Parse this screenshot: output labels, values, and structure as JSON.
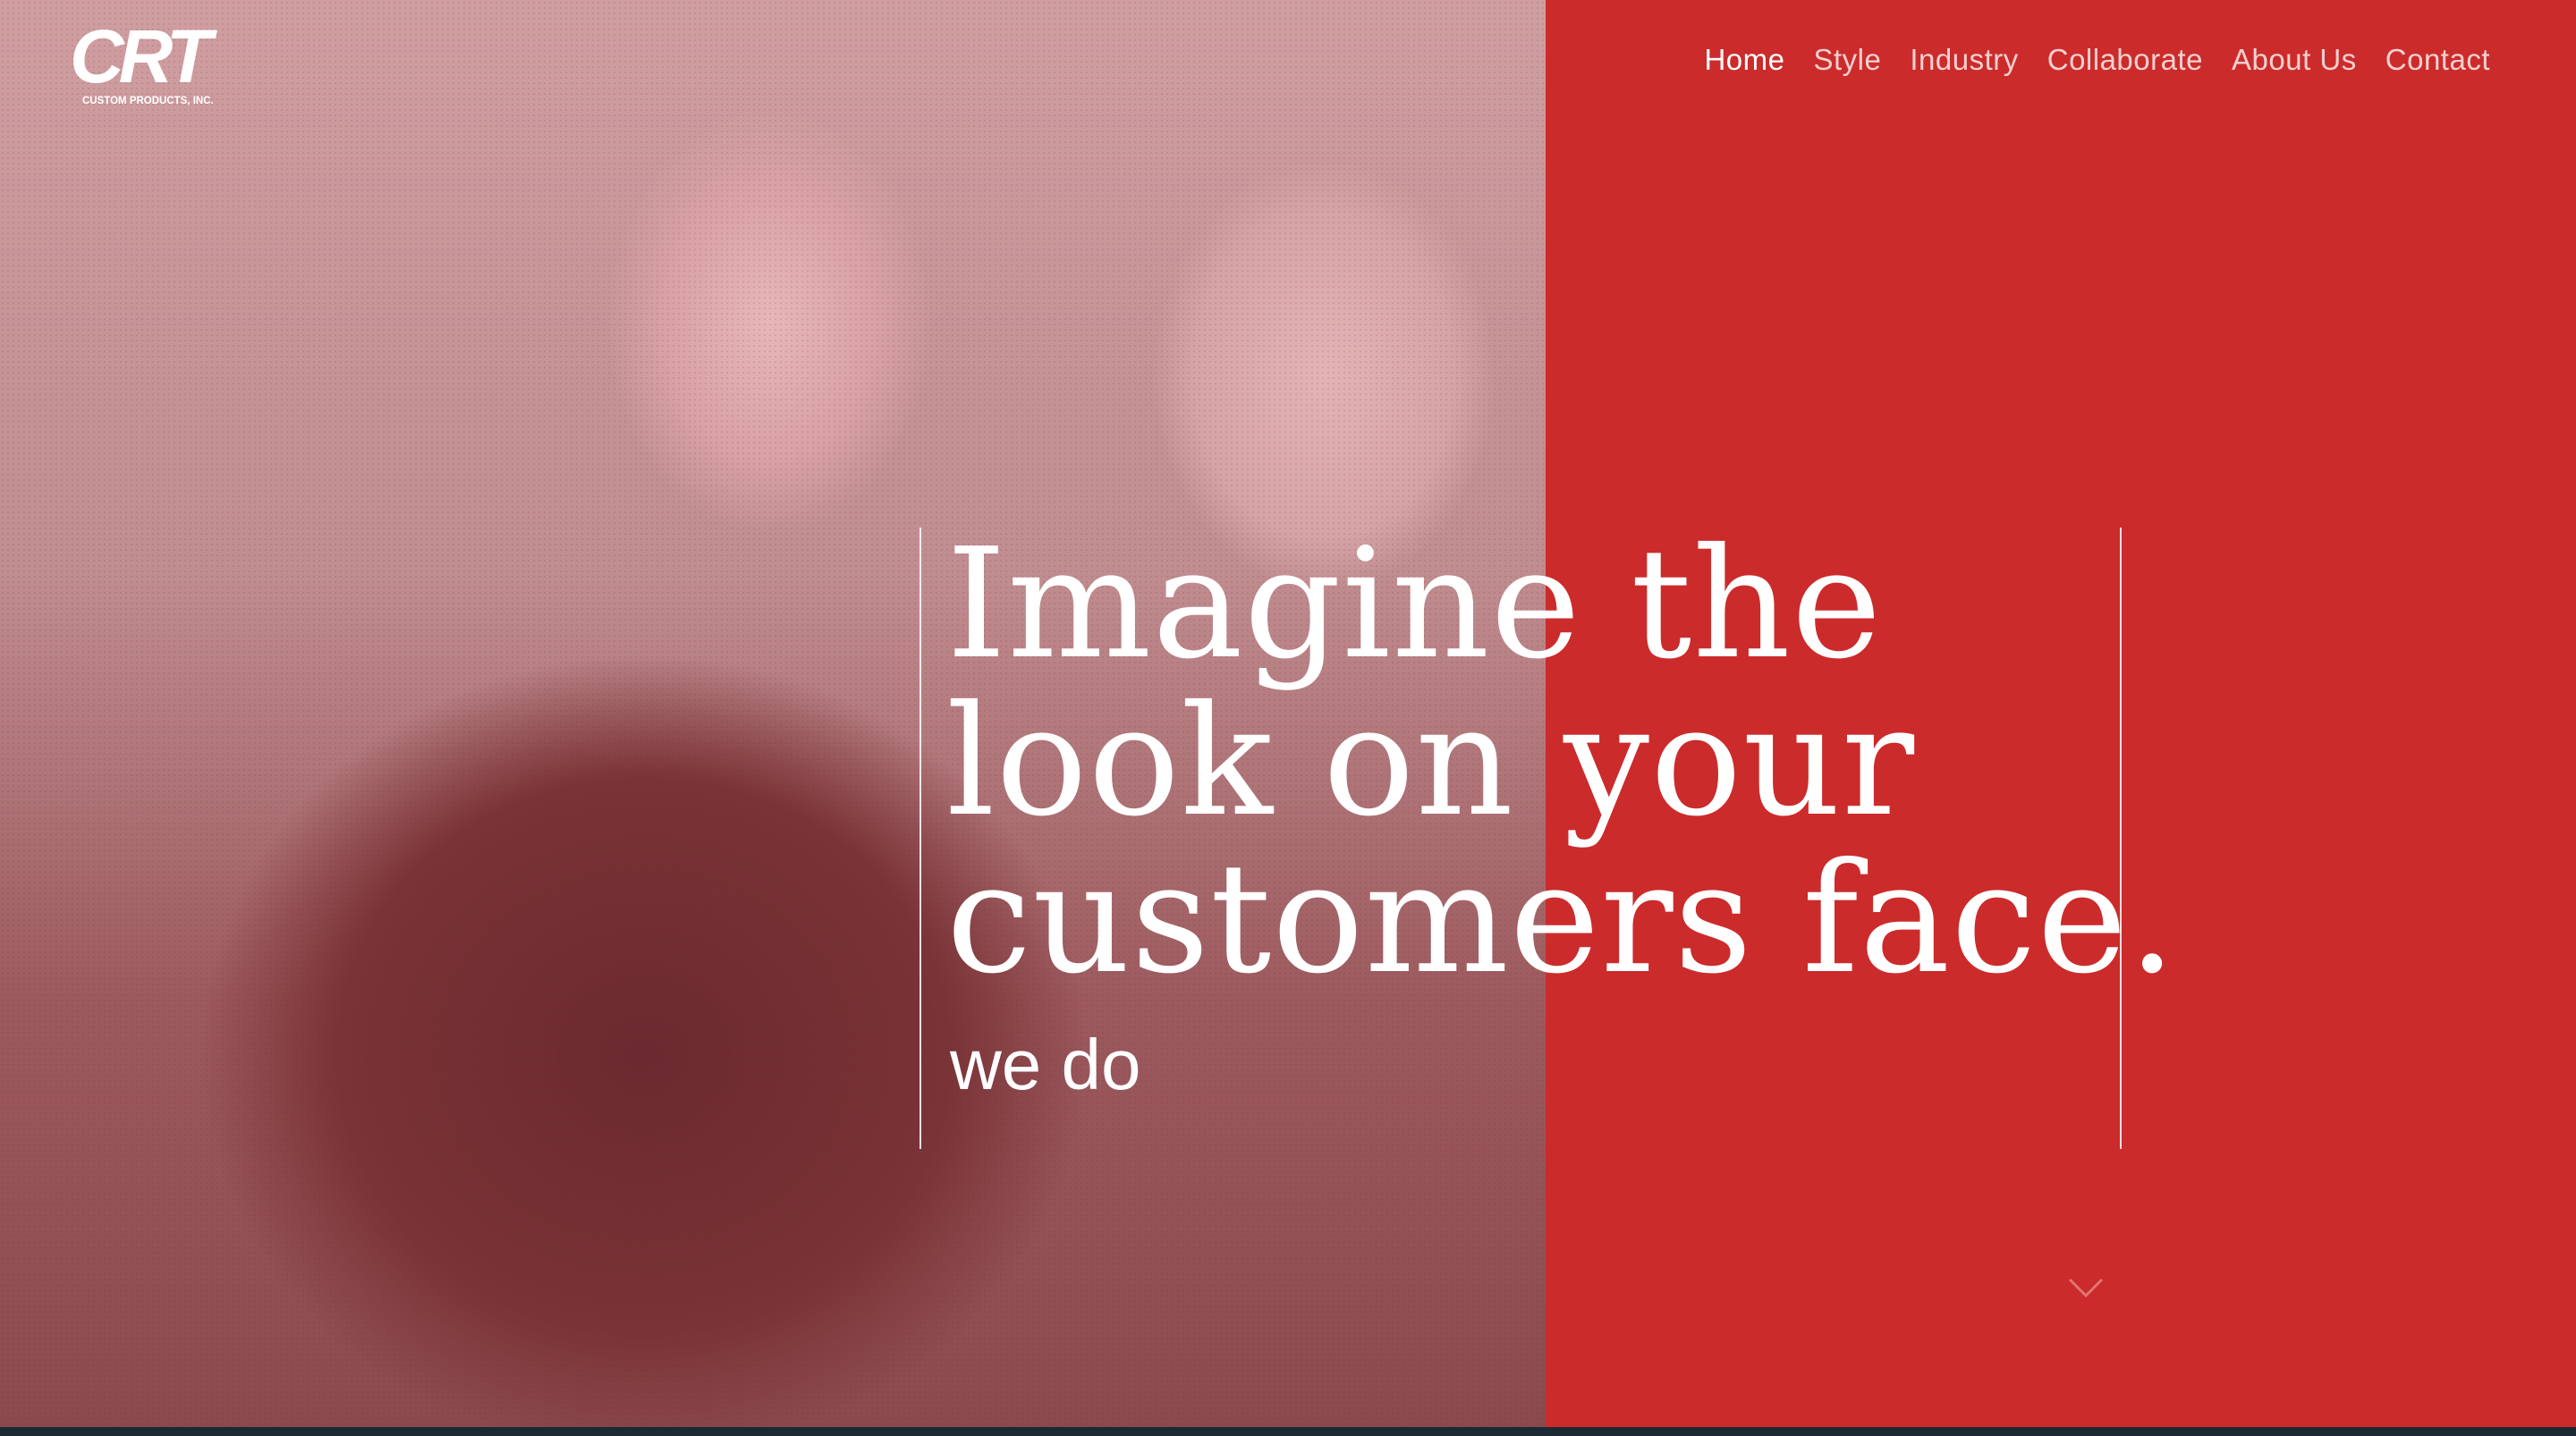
{
  "logo": {
    "mark": "CRT",
    "tagline": "CUSTOM PRODUCTS, INC."
  },
  "nav": {
    "items": [
      {
        "label": "Home",
        "active": true
      },
      {
        "label": "Style",
        "active": false
      },
      {
        "label": "Industry",
        "active": false
      },
      {
        "label": "Collaborate",
        "active": false
      },
      {
        "label": "About Us",
        "active": false
      },
      {
        "label": "Contact",
        "active": false
      }
    ]
  },
  "hero": {
    "headline_lines": [
      "Imagine the",
      "look on your",
      "customers face."
    ],
    "subline": "we do"
  },
  "colors": {
    "red_panel": "#cc2b2b",
    "text": "#ffffff"
  },
  "icons": {
    "scroll": "chevron-down-icon"
  }
}
